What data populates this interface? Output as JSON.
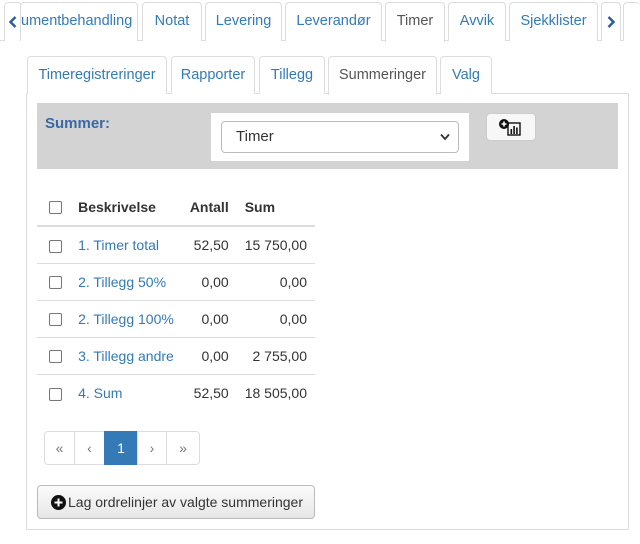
{
  "top_tabs": {
    "items": [
      {
        "label": "umentbehandling"
      },
      {
        "label": "Notat"
      },
      {
        "label": "Levering"
      },
      {
        "label": "Leverandør"
      },
      {
        "label": "Timer"
      },
      {
        "label": "Avvik"
      },
      {
        "label": "Sjekklister"
      }
    ],
    "active": "Timer"
  },
  "inner_tabs": {
    "items": [
      {
        "label": "Timeregistreringer"
      },
      {
        "label": "Rapporter"
      },
      {
        "label": "Tillegg"
      },
      {
        "label": "Summeringer"
      },
      {
        "label": "Valg"
      }
    ],
    "active": "Summeringer"
  },
  "summer": {
    "label": "Summer:",
    "selected": "Timer"
  },
  "table": {
    "headers": {
      "description": "Beskrivelse",
      "count": "Antall",
      "sum": "Sum"
    },
    "rows": [
      {
        "description": "1. Timer total",
        "count": "52,50",
        "sum": "15 750,00"
      },
      {
        "description": "2. Tillegg 50%",
        "count": "0,00",
        "sum": "0,00"
      },
      {
        "description": "2. Tillegg 100%",
        "count": "0,00",
        "sum": "0,00"
      },
      {
        "description": "3. Tillegg andre",
        "count": "0,00",
        "sum": "2 755,00"
      },
      {
        "description": "4. Sum",
        "count": "52,50",
        "sum": "18 505,00"
      }
    ]
  },
  "pagination": {
    "first": "«",
    "prev": "‹",
    "current": "1",
    "next": "›",
    "last": "»"
  },
  "actions": {
    "create_order_lines": "Lag ordrelinjer av valgte summeringer"
  },
  "colors": {
    "link": "#337ab7",
    "summary_bar": "#d3d3d3",
    "active_page": "#337ab7"
  }
}
